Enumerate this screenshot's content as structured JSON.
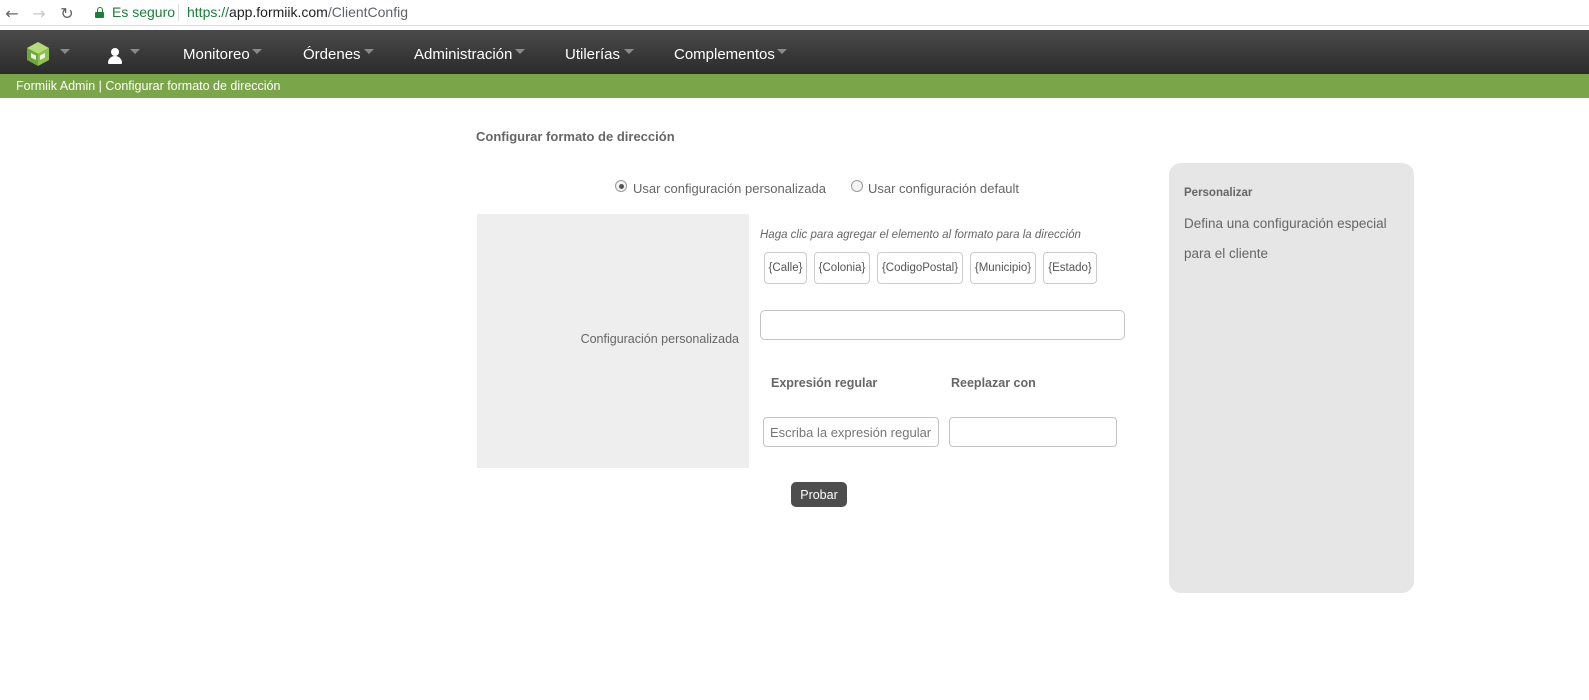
{
  "browser": {
    "secure_label": "Es seguro",
    "url_scheme": "https://",
    "url_host": "app.formiik.com",
    "url_path": "/ClientConfig",
    "back_glyph": "←",
    "forward_glyph": "→",
    "reload_glyph": "↻"
  },
  "topnav": {
    "logo_icon": "formiik-cube-logo",
    "user_icon": "user-icon",
    "menu": [
      {
        "label": "Monitoreo"
      },
      {
        "label": "Órdenes"
      },
      {
        "label": "Administración"
      },
      {
        "label": "Utilerías"
      },
      {
        "label": "Complementos"
      }
    ]
  },
  "breadcrumb": {
    "text": "Formiik Admin | Configurar formato de dirección"
  },
  "page": {
    "title": "Configurar formato de dirección"
  },
  "config_mode": {
    "options": [
      {
        "label": "Usar configuración personalizada",
        "checked": true
      },
      {
        "label": "Usar configuración default",
        "checked": false
      }
    ]
  },
  "form": {
    "row_label": "Configuración personalizada",
    "hint": "Haga clic para agregar el elemento al formato para la dirección",
    "tokens": [
      "{Calle}",
      "{Colonia}",
      "{CodigoPostal}",
      "{Municipio}",
      "{Estado}"
    ],
    "format_value": "",
    "regex_header": "Expresión regular",
    "replace_header": "Reeplazar con",
    "regex_placeholder": "Escriba la expresión regular",
    "replace_value": "",
    "test_button": "Probar"
  },
  "side_panel": {
    "title": "Personalizar",
    "text": "Defina una configuración especial para el cliente"
  },
  "colors": {
    "nav_bg": "#2b2b2b",
    "breadcrumb_bg": "#7aa649",
    "secure_green": "#188038",
    "button_bg": "#4d4d4d",
    "panel_bg": "#e6e6e6"
  }
}
